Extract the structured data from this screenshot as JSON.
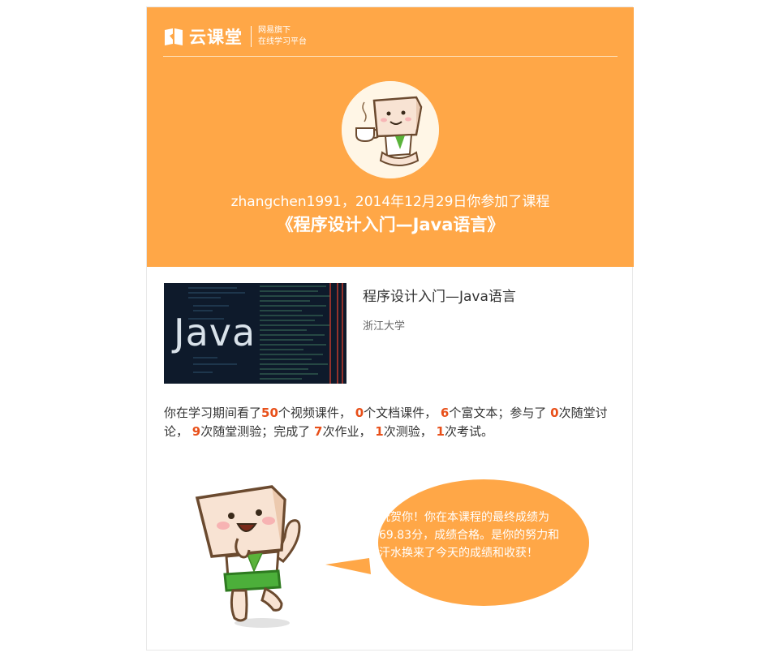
{
  "brand": {
    "name": "云课堂",
    "sub_line1": "网易旗下",
    "sub_line2": "在线学习平台"
  },
  "header": {
    "intro": "zhangchen1991，2014年12月29日你参加了课程",
    "course_title": "《程序设计入门—Java语言》"
  },
  "course": {
    "thumbnail_text": "Java",
    "name": "程序设计入门—Java语言",
    "school": "浙江大学"
  },
  "stats": {
    "t1": "你在学习期间看了",
    "video_count": "50",
    "t2": "个视频课件，",
    "doc_count": "0",
    "t3": "个文档课件，",
    "richtext_count": "6",
    "t4": "个富文本；参与了",
    "discussion_count": "0",
    "t5": "次随堂讨论，",
    "quiz_inclass_count": "9",
    "t6": "次随堂测验；完成了",
    "homework_count": "7",
    "t7": "次作业，",
    "test_count": "1",
    "t8": "次测验，",
    "exam_count": "1",
    "t9": "次考试。"
  },
  "bubble": {
    "message": "祝贺你！你在本课程的最终成绩为69.83分，成绩合格。是你的努力和汗水换来了今天的成绩和收获！"
  },
  "colors": {
    "header_bg": "#ffa747",
    "highlight": "#e8501a",
    "bubble_bg": "#ffa747"
  },
  "icons": [
    "book-logo-icon",
    "mascot-avatar",
    "mascot-cheering"
  ]
}
